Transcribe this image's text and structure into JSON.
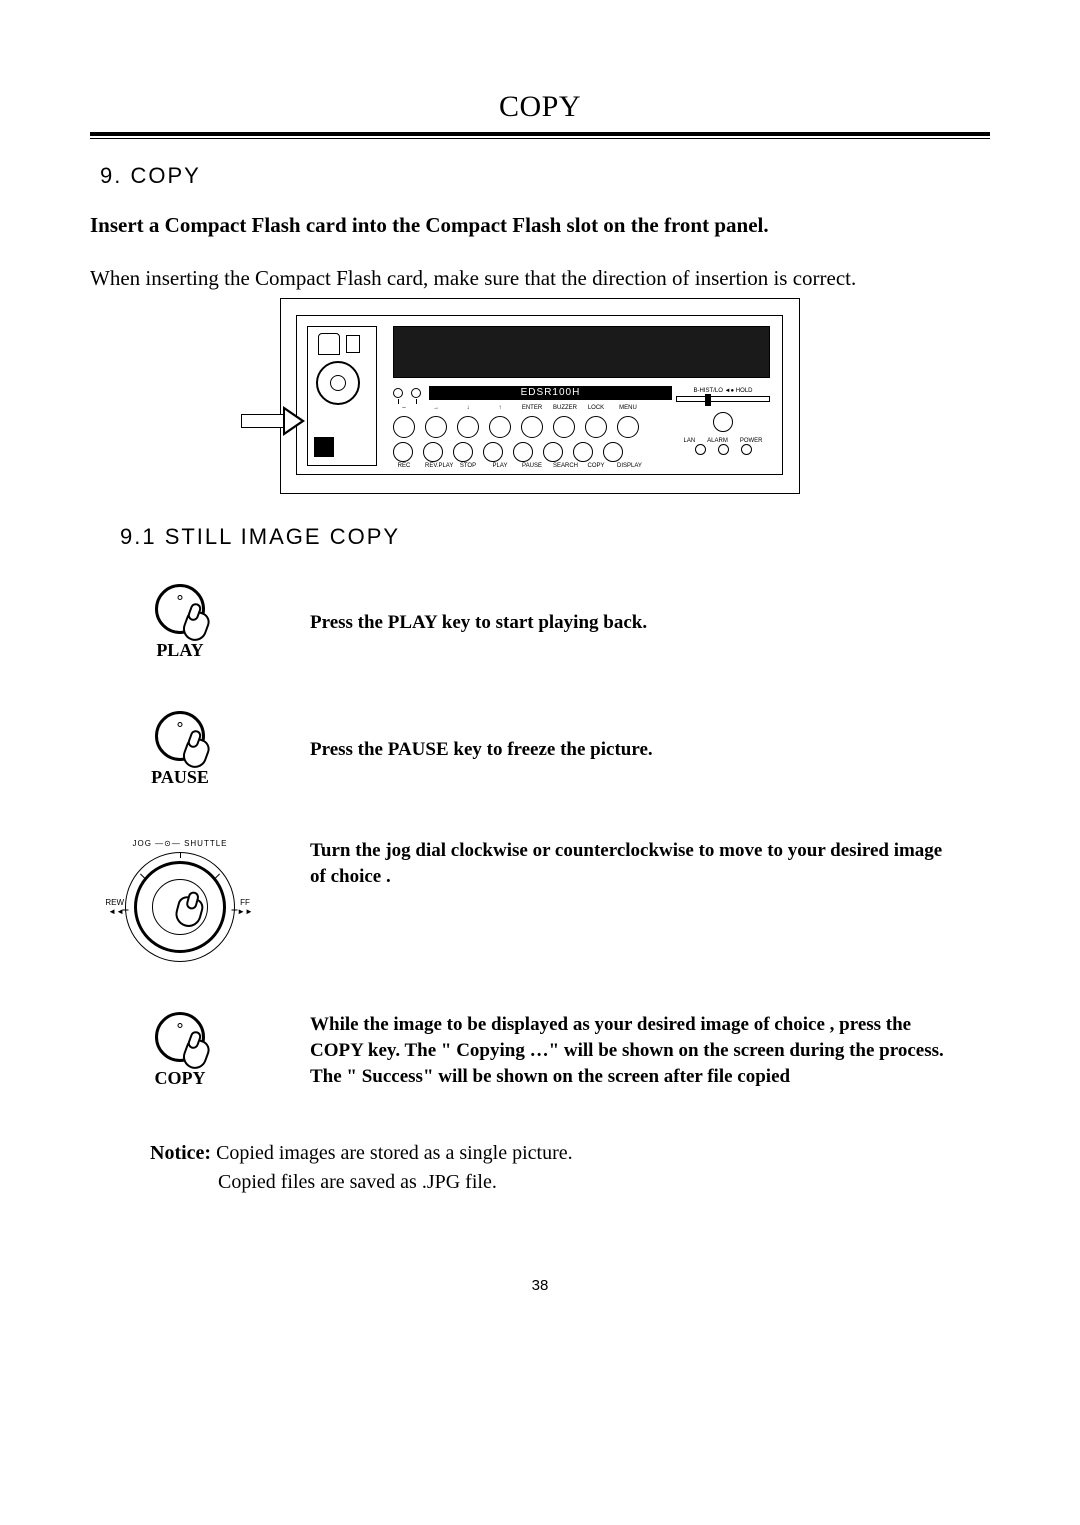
{
  "header": {
    "title": "COPY"
  },
  "section": {
    "number_title": "9. COPY"
  },
  "intro": {
    "bold": "Insert a Compact Flash card into the Compact Flash slot on the front panel.",
    "body": "When inserting the Compact Flash card, make sure that the direction of insertion is correct."
  },
  "device": {
    "model": "EDSR100H",
    "top_labels": [
      "",
      "",
      "",
      "",
      "ENTER",
      "BUZZER",
      "LOCK",
      "MENU"
    ],
    "bottom_labels": [
      "REC",
      "REV.PLAY",
      "STOP",
      "PLAY",
      "PAUSE",
      "SEARCH",
      "COPY",
      "DISPLAY"
    ],
    "slider_label": "B-HIST/LO ◄● HOLD",
    "led_labels": [
      "LAN",
      "ALARM",
      "POWER"
    ]
  },
  "subsection": {
    "title": "9.1 STILL IMAGE COPY"
  },
  "steps": {
    "play": {
      "label": "PLAY",
      "text": "Press the PLAY key to start playing back."
    },
    "pause": {
      "label": "PAUSE",
      "text": "Press the PAUSE key to freeze the picture."
    },
    "jog": {
      "top": "JOG —⊙— SHUTTLE",
      "left": "REW\n◄◄",
      "right": "FF\n►►",
      "text": "Turn the jog dial clockwise or counterclockwise to move to your desired image of choice   ."
    },
    "copy": {
      "label": "COPY",
      "text": "While the image to be displayed as your desired image of choice , press the COPY key. The \" Copying …\"  will be shown on the screen during the process. The \" Success\" will be shown on the screen after file copied"
    }
  },
  "notice": {
    "label": "Notice:",
    "line1": "Copied images are stored as a single picture.",
    "line2": "Copied files are saved as .JPG file."
  },
  "page_number": "38"
}
